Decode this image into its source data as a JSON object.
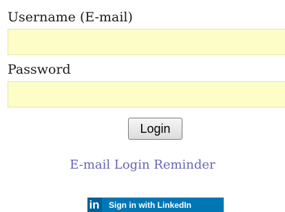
{
  "form": {
    "username_label": "Username (E-mail)",
    "username_value": "",
    "password_label": "Password",
    "password_value": "",
    "login_label": "Login",
    "reminder_link": "E-mail Login Reminder"
  },
  "linkedin": {
    "icon_text": "in",
    "label": "Sign in with LinkedIn"
  },
  "colors": {
    "field_background": "#fdfdc8",
    "link": "#6565b8",
    "linkedin_brand": "#0077b5"
  }
}
